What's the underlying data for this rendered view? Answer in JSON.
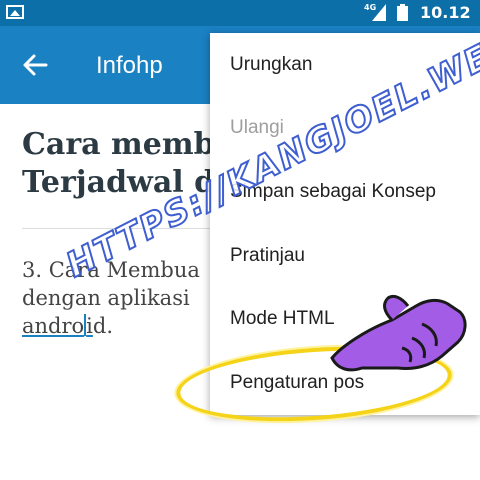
{
  "status_bar": {
    "network": "4G",
    "time": "10.12"
  },
  "app_bar": {
    "title": "Infohp"
  },
  "post": {
    "title": "Cara membuat Postingan Terjadwal di Blogger",
    "title_line1": "Cara membi",
    "title_line2": "Terjadwal d",
    "body_line1": "3. Cara Membua",
    "body_line2": "dengan aplikasi",
    "body_line3_underlined_a": "andro",
    "body_line3_underlined_b": "i",
    "body_line3_rest": "d."
  },
  "menu": {
    "items": [
      {
        "label": "Urungkan",
        "enabled": true
      },
      {
        "label": "Ulangi",
        "enabled": false
      },
      {
        "label": "Simpan sebagai Konsep",
        "enabled": true
      },
      {
        "label": "Pratinjau",
        "enabled": true
      },
      {
        "label": "Mode HTML",
        "enabled": true
      },
      {
        "label": "Pengaturan pos",
        "enabled": true
      }
    ]
  },
  "watermark": "HTTPS://KANGJOEL.WEB.ID",
  "colors": {
    "status_bar": "#0c6fa7",
    "app_bar": "#1a81c3",
    "highlight": "#f5d319",
    "hand": "#a35ce6"
  }
}
